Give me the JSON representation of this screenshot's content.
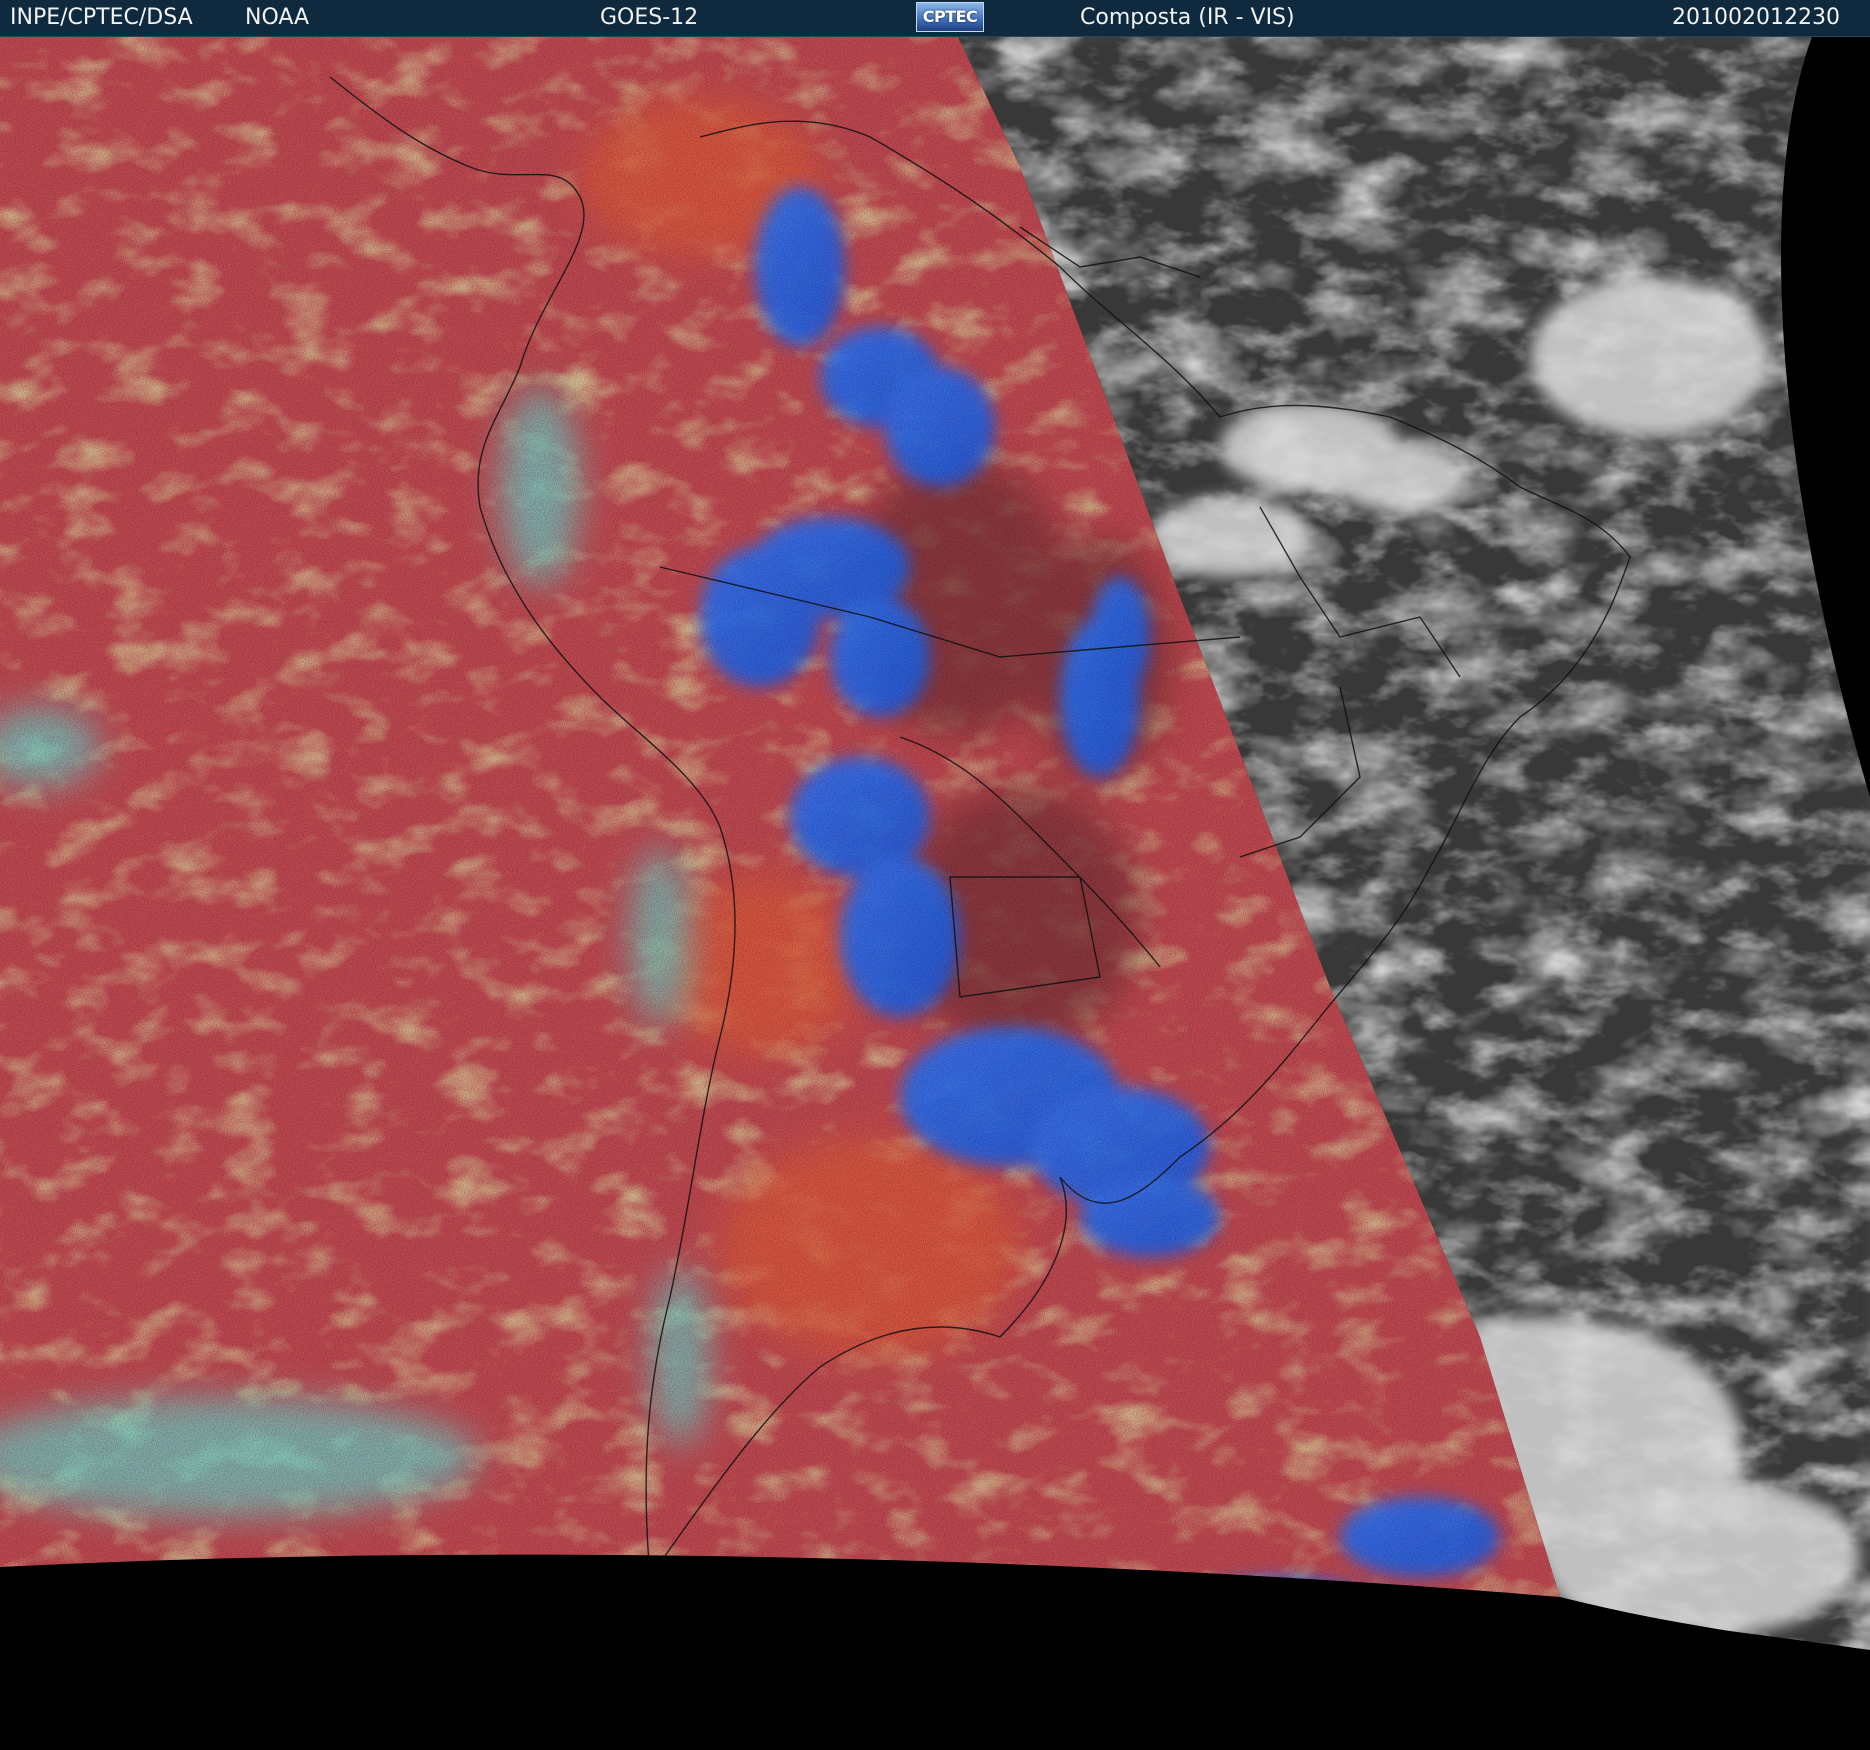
{
  "header": {
    "agency": "INPE/CPTEC/DSA",
    "partner": "NOAA",
    "satellite": "GOES-12",
    "logo_text": "CPTEC",
    "product": "Composta (IR - VIS)",
    "timestamp": "201002012230"
  },
  "colors": {
    "header_bg": "#0f2a3e",
    "ir_red": "#c24a52",
    "ir_orange": "#e05a3c",
    "ir_blue": "#2a6cf0",
    "ir_cyan": "#6ad8d0",
    "ir_green": "#b7b45a",
    "vis_gray": "#4a4a4a",
    "space": "#000000"
  }
}
